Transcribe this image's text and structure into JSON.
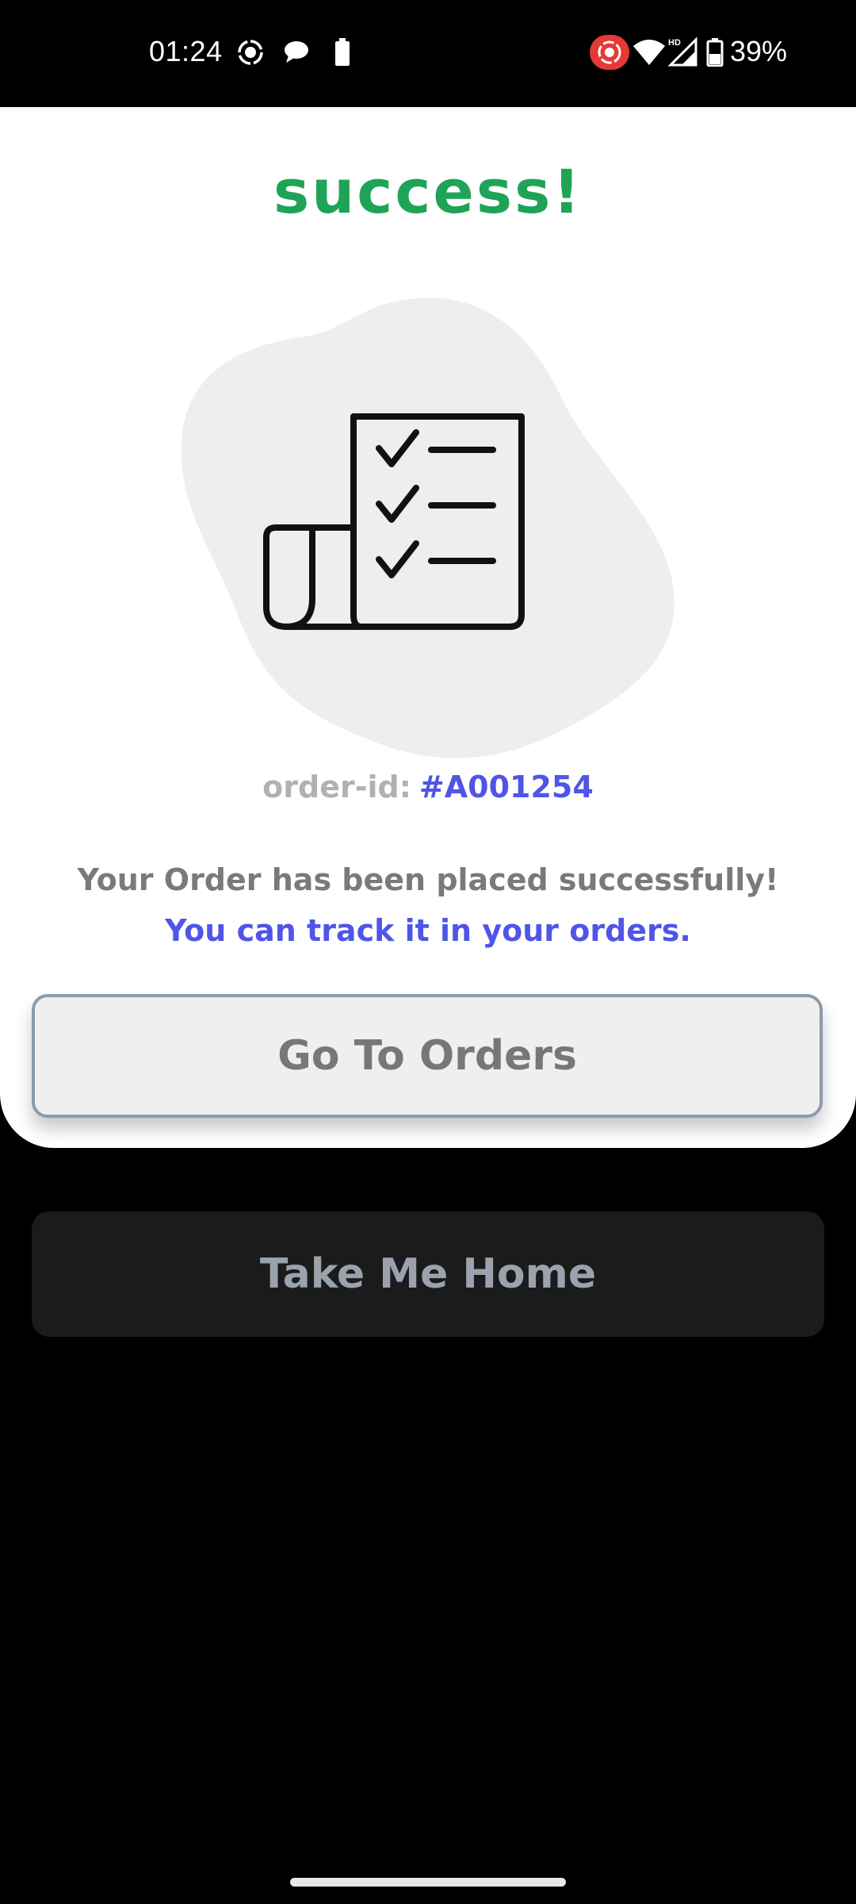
{
  "status_bar": {
    "time": "01:24",
    "battery_percent": "39%",
    "icons": [
      "screen-record-icon",
      "chat-bubble-icon",
      "battery-small-icon",
      "record-badge-icon",
      "wifi-icon",
      "hd-signal-icon",
      "battery-icon"
    ]
  },
  "main": {
    "title": "success!",
    "order_label": "order-id:",
    "order_id": "#A001254",
    "message_line1": "Your Order has been placed successfully!",
    "message_line2": "You can track it in your orders.",
    "go_to_orders": "Go To Orders"
  },
  "footer": {
    "take_me_home": "Take Me Home"
  },
  "colors": {
    "success_green": "#1fa356",
    "accent_blue": "#4f55e6",
    "text_gray": "#7a7a7a",
    "background": "#000000"
  }
}
